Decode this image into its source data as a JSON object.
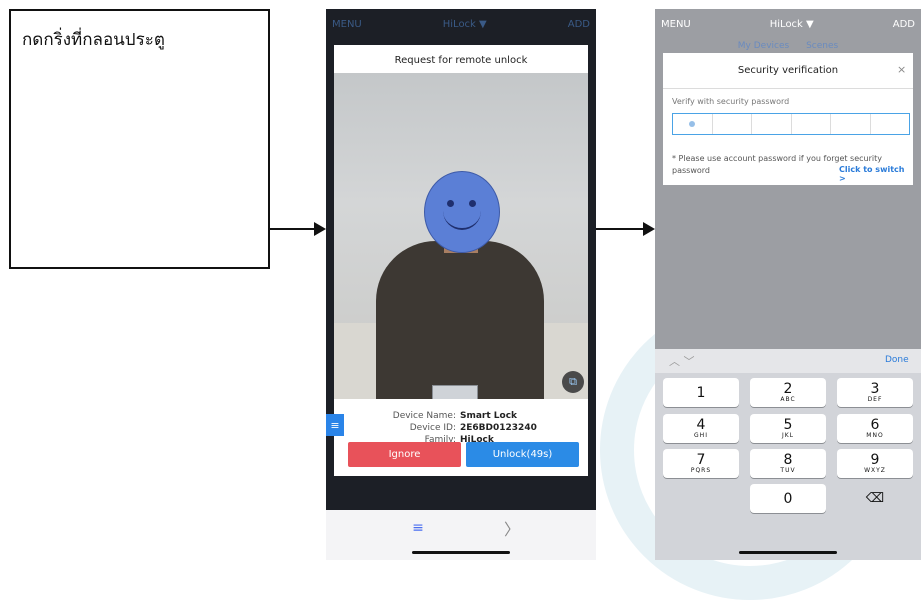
{
  "note": {
    "text": "กดกริ่งที่กลอนประตู"
  },
  "phone1": {
    "topbar": {
      "menu": "MENU",
      "title": "HiLock ▼",
      "add": "ADD"
    },
    "title": "Request for remote unlock",
    "info": {
      "device_name_label": "Device Name:",
      "device_name": "Smart Lock",
      "device_id_label": "Device ID:",
      "device_id": "2E6BD0123240",
      "family_label": "Family:",
      "family": "HiLock"
    },
    "ignore_label": "Ignore",
    "unlock_label": "Unlock(49s)",
    "bottom_nav": {
      "menu_icon": "≡",
      "next_icon": "〉"
    }
  },
  "phone2": {
    "topbar": {
      "menu": "MENU",
      "title": "HiLock ▼",
      "add": "ADD"
    },
    "tabs": {
      "my_devices": "My Devices",
      "scenes": "Scenes"
    },
    "dialog": {
      "title": "Security verification",
      "close": "×",
      "verify_label": "Verify with security password",
      "hint": "* Please use account password if you forget security password",
      "switch_link": "Click to switch >"
    },
    "keyboard": {
      "arrows": "︿  ﹀",
      "done": "Done",
      "keys": [
        {
          "num": "1",
          "sub": ""
        },
        {
          "num": "2",
          "sub": "ABC"
        },
        {
          "num": "3",
          "sub": "DEF"
        },
        {
          "num": "4",
          "sub": "GHI"
        },
        {
          "num": "5",
          "sub": "JKL"
        },
        {
          "num": "6",
          "sub": "MNO"
        },
        {
          "num": "7",
          "sub": "PQRS"
        },
        {
          "num": "8",
          "sub": "TUV"
        },
        {
          "num": "9",
          "sub": "WXYZ"
        },
        {
          "num": "0",
          "sub": ""
        }
      ],
      "backspace": "⌫"
    }
  },
  "colors": {
    "ignore": "#e8525a",
    "unlock": "#2b8be6",
    "link": "#2a7bd9",
    "face": "#5b7fd6"
  }
}
